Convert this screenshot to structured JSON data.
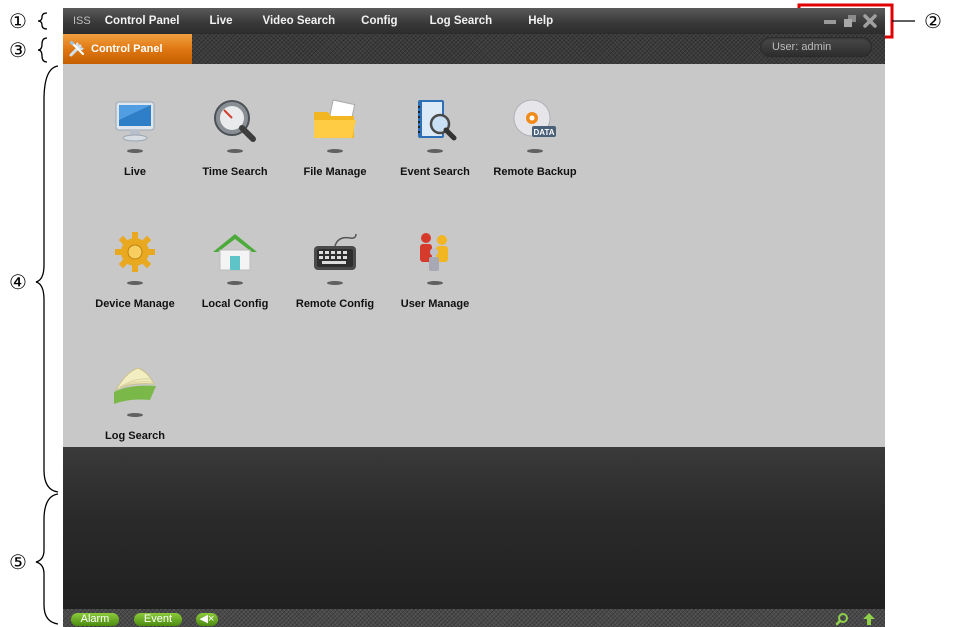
{
  "annotations": [
    "①",
    "②",
    "③",
    "④",
    "⑤"
  ],
  "menu": {
    "logo": "ISS",
    "items": [
      "Control Panel",
      "Live",
      "Video Search",
      "Config",
      "Log Search",
      "Help"
    ]
  },
  "window_controls": {
    "icons": [
      "minimize-icon",
      "restore-icon",
      "close-icon"
    ]
  },
  "tab": {
    "label": "Control Panel",
    "icon": "tools-icon"
  },
  "user": {
    "label": "User: admin"
  },
  "control_panel": {
    "items": [
      {
        "label": "Live",
        "icon": "monitor-icon"
      },
      {
        "label": "Time Search",
        "icon": "magnifier-gauge-icon"
      },
      {
        "label": "File Manage",
        "icon": "folder-icon"
      },
      {
        "label": "Event Search",
        "icon": "notebook-search-icon"
      },
      {
        "label": "Remote Backup",
        "icon": "data-disc-icon"
      },
      {
        "label": "Device Manage",
        "icon": "gear-icon"
      },
      {
        "label": "Local Config",
        "icon": "house-icon"
      },
      {
        "label": "Remote Config",
        "icon": "keyboard-icon"
      },
      {
        "label": "User Manage",
        "icon": "users-icon"
      },
      {
        "label": "Log Search",
        "icon": "book-icon"
      }
    ],
    "disc_text": "DATA"
  },
  "status": {
    "alarm_label": "Alarm",
    "event_label": "Event",
    "mute_label": "◀×",
    "icons": [
      "search-icon",
      "arrow-up-icon"
    ]
  },
  "colors": {
    "accent_orange": "#e07812",
    "status_green": "#6aaa24",
    "panel_gray": "#c8c8c8",
    "annotation_red": "#e00000"
  }
}
